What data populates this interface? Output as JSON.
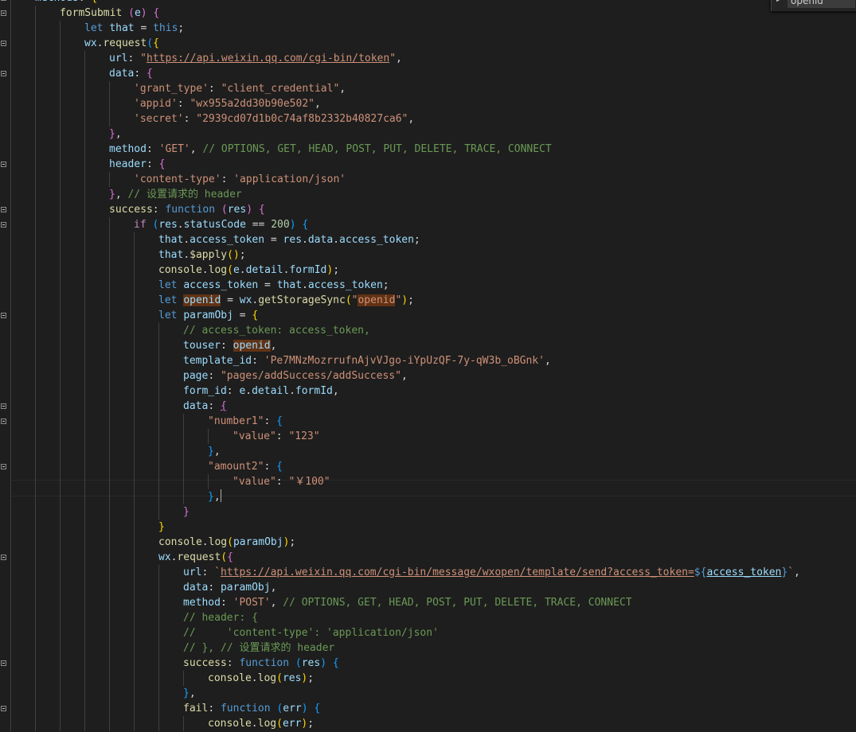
{
  "editor": {
    "cursor_line": 33,
    "lines": [
      {
        "indent": 1,
        "fold": true,
        "tokens": [
          [
            "methods",
            "v"
          ],
          [
            ": ",
            "p"
          ],
          [
            "{",
            "b1"
          ]
        ]
      },
      {
        "indent": 2,
        "fold": true,
        "tokens": [
          [
            "formSubmit",
            "f"
          ],
          [
            " ",
            "p"
          ],
          [
            "(",
            "b2"
          ],
          [
            "e",
            "v"
          ],
          [
            ")",
            "b2"
          ],
          [
            " ",
            "p"
          ],
          [
            "{",
            "b2"
          ]
        ]
      },
      {
        "indent": 3,
        "fold": false,
        "tokens": [
          [
            "let",
            "k"
          ],
          [
            " ",
            "p"
          ],
          [
            "that",
            "v"
          ],
          [
            " = ",
            "p"
          ],
          [
            "this",
            "k"
          ],
          [
            ";",
            "p"
          ]
        ]
      },
      {
        "indent": 3,
        "fold": true,
        "tokens": [
          [
            "wx",
            "v"
          ],
          [
            ".",
            "p"
          ],
          [
            "request",
            "f"
          ],
          [
            "(",
            "b3"
          ],
          [
            "{",
            "b1"
          ]
        ]
      },
      {
        "indent": 4,
        "fold": false,
        "tokens": [
          [
            "url",
            "v"
          ],
          [
            ": ",
            "p"
          ],
          [
            "\"",
            "s"
          ],
          [
            "https://api.weixin.qq.com/cgi-bin/token",
            "su"
          ],
          [
            "\"",
            "s"
          ],
          [
            ",",
            "p"
          ]
        ]
      },
      {
        "indent": 4,
        "fold": true,
        "tokens": [
          [
            "data",
            "v"
          ],
          [
            ": ",
            "p"
          ],
          [
            "{",
            "b2"
          ]
        ]
      },
      {
        "indent": 5,
        "fold": false,
        "tokens": [
          [
            "'grant_type'",
            "s"
          ],
          [
            ": ",
            "p"
          ],
          [
            "\"client_credential\"",
            "s"
          ],
          [
            ",",
            "p"
          ]
        ]
      },
      {
        "indent": 5,
        "fold": false,
        "tokens": [
          [
            "'appid'",
            "s"
          ],
          [
            ": ",
            "p"
          ],
          [
            "\"wx955a2dd30b90e502\"",
            "s"
          ],
          [
            ",",
            "p"
          ]
        ]
      },
      {
        "indent": 5,
        "fold": false,
        "tokens": [
          [
            "'secret'",
            "s"
          ],
          [
            ": ",
            "p"
          ],
          [
            "\"2939cd07d1b0c74af8b2332b40827ca6\"",
            "s"
          ],
          [
            ",",
            "p"
          ]
        ]
      },
      {
        "indent": 4,
        "fold": false,
        "tokens": [
          [
            "}",
            "b2"
          ],
          [
            ",",
            "p"
          ]
        ]
      },
      {
        "indent": 4,
        "fold": false,
        "tokens": [
          [
            "method",
            "v"
          ],
          [
            ": ",
            "p"
          ],
          [
            "'GET'",
            "s"
          ],
          [
            ", ",
            "p"
          ],
          [
            "// OPTIONS, GET, HEAD, POST, PUT, DELETE, TRACE, CONNECT",
            "cm"
          ]
        ]
      },
      {
        "indent": 4,
        "fold": true,
        "tokens": [
          [
            "header",
            "v"
          ],
          [
            ": ",
            "p"
          ],
          [
            "{",
            "b2"
          ]
        ]
      },
      {
        "indent": 5,
        "fold": false,
        "tokens": [
          [
            "'content-type'",
            "s"
          ],
          [
            ": ",
            "p"
          ],
          [
            "'application/json'",
            "s"
          ]
        ]
      },
      {
        "indent": 4,
        "fold": false,
        "tokens": [
          [
            "}",
            "b2"
          ],
          [
            ", ",
            "p"
          ],
          [
            "// 设置请求的 header",
            "cm"
          ]
        ]
      },
      {
        "indent": 4,
        "fold": true,
        "tokens": [
          [
            "success",
            "f"
          ],
          [
            ": ",
            "p"
          ],
          [
            "function",
            "k"
          ],
          [
            " ",
            "p"
          ],
          [
            "(",
            "b2"
          ],
          [
            "res",
            "v"
          ],
          [
            ")",
            "b2"
          ],
          [
            " ",
            "p"
          ],
          [
            "{",
            "b2"
          ]
        ]
      },
      {
        "indent": 5,
        "fold": true,
        "tokens": [
          [
            "if",
            "c"
          ],
          [
            " ",
            "p"
          ],
          [
            "(",
            "b3"
          ],
          [
            "res",
            "v"
          ],
          [
            ".",
            "p"
          ],
          [
            "statusCode",
            "v"
          ],
          [
            " == ",
            "p"
          ],
          [
            "200",
            "n"
          ],
          [
            ")",
            "b3"
          ],
          [
            " ",
            "p"
          ],
          [
            "{",
            "b3"
          ]
        ]
      },
      {
        "indent": 6,
        "fold": false,
        "tokens": [
          [
            "that",
            "v"
          ],
          [
            ".",
            "p"
          ],
          [
            "access_token",
            "v"
          ],
          [
            " = ",
            "p"
          ],
          [
            "res",
            "v"
          ],
          [
            ".",
            "p"
          ],
          [
            "data",
            "v"
          ],
          [
            ".",
            "p"
          ],
          [
            "access_token",
            "v"
          ],
          [
            ";",
            "p"
          ]
        ]
      },
      {
        "indent": 6,
        "fold": false,
        "tokens": [
          [
            "that",
            "v"
          ],
          [
            ".",
            "p"
          ],
          [
            "$apply",
            "f"
          ],
          [
            "(",
            "b1"
          ],
          [
            ")",
            "b1"
          ],
          [
            ";",
            "p"
          ]
        ]
      },
      {
        "indent": 6,
        "fold": false,
        "tokens": [
          [
            "console",
            "f"
          ],
          [
            ".",
            "p"
          ],
          [
            "log",
            "f"
          ],
          [
            "(",
            "b1"
          ],
          [
            "e",
            "v"
          ],
          [
            ".",
            "p"
          ],
          [
            "detail",
            "v"
          ],
          [
            ".",
            "p"
          ],
          [
            "formId",
            "v"
          ],
          [
            ")",
            "b1"
          ],
          [
            ";",
            "p"
          ]
        ]
      },
      {
        "indent": 6,
        "fold": false,
        "tokens": [
          [
            "let",
            "k"
          ],
          [
            " ",
            "p"
          ],
          [
            "access_token",
            "v"
          ],
          [
            " = ",
            "p"
          ],
          [
            "that",
            "v"
          ],
          [
            ".",
            "p"
          ],
          [
            "access_token",
            "v"
          ],
          [
            ";",
            "p"
          ]
        ]
      },
      {
        "indent": 6,
        "fold": false,
        "tokens": [
          [
            "let",
            "k"
          ],
          [
            " ",
            "p"
          ],
          [
            "openid",
            "vh"
          ],
          [
            " = ",
            "p"
          ],
          [
            "wx",
            "v"
          ],
          [
            ".",
            "p"
          ],
          [
            "getStorageSync",
            "f"
          ],
          [
            "(",
            "b1"
          ],
          [
            "\"",
            "s"
          ],
          [
            "openid",
            "sh"
          ],
          [
            "\"",
            "s"
          ],
          [
            ")",
            "b1"
          ],
          [
            ";",
            "p"
          ]
        ]
      },
      {
        "indent": 6,
        "fold": true,
        "tokens": [
          [
            "let",
            "k"
          ],
          [
            " ",
            "p"
          ],
          [
            "paramObj",
            "v"
          ],
          [
            " = ",
            "p"
          ],
          [
            "{",
            "b1"
          ]
        ]
      },
      {
        "indent": 7,
        "fold": false,
        "tokens": [
          [
            "// access_token: access_token,",
            "cm"
          ]
        ]
      },
      {
        "indent": 7,
        "fold": false,
        "tokens": [
          [
            "touser",
            "v"
          ],
          [
            ": ",
            "p"
          ],
          [
            "openid",
            "vh"
          ],
          [
            ",",
            "p"
          ]
        ]
      },
      {
        "indent": 7,
        "fold": false,
        "tokens": [
          [
            "template_id",
            "v"
          ],
          [
            ": ",
            "p"
          ],
          [
            "'Pe7MNzMozrrufnAjvVJgo-iYpUzQF-7y-qW3b_oBGnk'",
            "s"
          ],
          [
            ",",
            "p"
          ]
        ]
      },
      {
        "indent": 7,
        "fold": false,
        "tokens": [
          [
            "page",
            "v"
          ],
          [
            ": ",
            "p"
          ],
          [
            "\"pages/addSuccess/addSuccess\"",
            "s"
          ],
          [
            ",",
            "p"
          ]
        ]
      },
      {
        "indent": 7,
        "fold": false,
        "tokens": [
          [
            "form_id",
            "v"
          ],
          [
            ": ",
            "p"
          ],
          [
            "e",
            "v"
          ],
          [
            ".",
            "p"
          ],
          [
            "detail",
            "v"
          ],
          [
            ".",
            "p"
          ],
          [
            "formId",
            "v"
          ],
          [
            ",",
            "p"
          ]
        ]
      },
      {
        "indent": 7,
        "fold": true,
        "tokens": [
          [
            "data",
            "v"
          ],
          [
            ": ",
            "p"
          ],
          [
            "{",
            "b2u"
          ]
        ]
      },
      {
        "indent": 8,
        "fold": true,
        "tokens": [
          [
            "\"number1\"",
            "s"
          ],
          [
            ": ",
            "p"
          ],
          [
            "{",
            "b3"
          ]
        ]
      },
      {
        "indent": 9,
        "fold": false,
        "tokens": [
          [
            "\"value\"",
            "s"
          ],
          [
            ": ",
            "p"
          ],
          [
            "\"123\"",
            "s"
          ]
        ]
      },
      {
        "indent": 8,
        "fold": false,
        "tokens": [
          [
            "}",
            "b3"
          ],
          [
            ",",
            "p"
          ]
        ]
      },
      {
        "indent": 8,
        "fold": true,
        "tokens": [
          [
            "\"amount2\"",
            "s"
          ],
          [
            ": ",
            "p"
          ],
          [
            "{",
            "b3"
          ]
        ]
      },
      {
        "indent": 9,
        "fold": false,
        "tokens": [
          [
            "\"value\"",
            "s"
          ],
          [
            ": ",
            "p"
          ],
          [
            "\"￥100\"",
            "s"
          ]
        ]
      },
      {
        "indent": 8,
        "fold": false,
        "tokens": [
          [
            "}",
            "b3"
          ],
          [
            ",",
            "p"
          ]
        ]
      },
      {
        "indent": 7,
        "fold": false,
        "tokens": [
          [
            "}",
            "b2x"
          ]
        ]
      },
      {
        "indent": 6,
        "fold": false,
        "tokens": [
          [
            "}",
            "b1"
          ]
        ]
      },
      {
        "indent": 6,
        "fold": false,
        "tokens": [
          [
            "console",
            "f"
          ],
          [
            ".",
            "p"
          ],
          [
            "log",
            "f"
          ],
          [
            "(",
            "b1"
          ],
          [
            "paramObj",
            "v"
          ],
          [
            ")",
            "b1"
          ],
          [
            ";",
            "p"
          ]
        ]
      },
      {
        "indent": 6,
        "fold": true,
        "tokens": [
          [
            "wx",
            "v"
          ],
          [
            ".",
            "p"
          ],
          [
            "request",
            "f"
          ],
          [
            "(",
            "b1"
          ],
          [
            "{",
            "b2"
          ]
        ]
      },
      {
        "indent": 7,
        "fold": false,
        "tokens": [
          [
            "url",
            "v"
          ],
          [
            ": ",
            "p"
          ],
          [
            "`",
            "s"
          ],
          [
            "https://api.weixin.qq.com/cgi-bin/message/wxopen/template/send?access_token=",
            "su"
          ],
          [
            "${",
            "k"
          ],
          [
            "access_token",
            "vu"
          ],
          [
            "}",
            "k"
          ],
          [
            "`",
            "s"
          ],
          [
            ",",
            "p"
          ]
        ]
      },
      {
        "indent": 7,
        "fold": false,
        "tokens": [
          [
            "data",
            "v"
          ],
          [
            ": ",
            "p"
          ],
          [
            "paramObj",
            "v"
          ],
          [
            ",",
            "p"
          ]
        ]
      },
      {
        "indent": 7,
        "fold": false,
        "tokens": [
          [
            "method",
            "v"
          ],
          [
            ": ",
            "p"
          ],
          [
            "'POST'",
            "s"
          ],
          [
            ", ",
            "p"
          ],
          [
            "// OPTIONS, GET, HEAD, POST, PUT, DELETE, TRACE, CONNECT",
            "cm"
          ]
        ]
      },
      {
        "indent": 7,
        "fold": false,
        "tokens": [
          [
            "// header: {",
            "cm"
          ]
        ]
      },
      {
        "indent": 7,
        "fold": false,
        "tokens": [
          [
            "//     'content-type': 'application/json'",
            "cm"
          ]
        ]
      },
      {
        "indent": 7,
        "fold": false,
        "tokens": [
          [
            "// }, // 设置请求的 header",
            "cm"
          ]
        ]
      },
      {
        "indent": 7,
        "fold": true,
        "tokens": [
          [
            "success",
            "f"
          ],
          [
            ": ",
            "p"
          ],
          [
            "function",
            "k"
          ],
          [
            " ",
            "p"
          ],
          [
            "(",
            "b3"
          ],
          [
            "res",
            "v"
          ],
          [
            ")",
            "b3"
          ],
          [
            " ",
            "p"
          ],
          [
            "{",
            "b3"
          ]
        ]
      },
      {
        "indent": 8,
        "fold": false,
        "tokens": [
          [
            "console",
            "f"
          ],
          [
            ".",
            "p"
          ],
          [
            "log",
            "f"
          ],
          [
            "(",
            "b1"
          ],
          [
            "res",
            "v"
          ],
          [
            ")",
            "b1"
          ],
          [
            ";",
            "p"
          ]
        ]
      },
      {
        "indent": 7,
        "fold": false,
        "tokens": [
          [
            "}",
            "b3"
          ],
          [
            ",",
            "p"
          ]
        ]
      },
      {
        "indent": 7,
        "fold": true,
        "tokens": [
          [
            "fail",
            "f"
          ],
          [
            ": ",
            "p"
          ],
          [
            "function",
            "k"
          ],
          [
            " ",
            "p"
          ],
          [
            "(",
            "b3"
          ],
          [
            "err",
            "v"
          ],
          [
            ")",
            "b3"
          ],
          [
            " ",
            "p"
          ],
          [
            "{",
            "b3"
          ]
        ]
      },
      {
        "indent": 8,
        "fold": false,
        "tokens": [
          [
            "console",
            "f"
          ],
          [
            ".",
            "p"
          ],
          [
            "log",
            "f"
          ],
          [
            "(",
            "b1"
          ],
          [
            "err",
            "v"
          ],
          [
            ")",
            "b1"
          ],
          [
            ";",
            "p"
          ]
        ]
      }
    ]
  },
  "find_widget": {
    "toggle_icon": "triangle-right-icon",
    "toggle_glyph": "▶",
    "search_value": "openid"
  }
}
